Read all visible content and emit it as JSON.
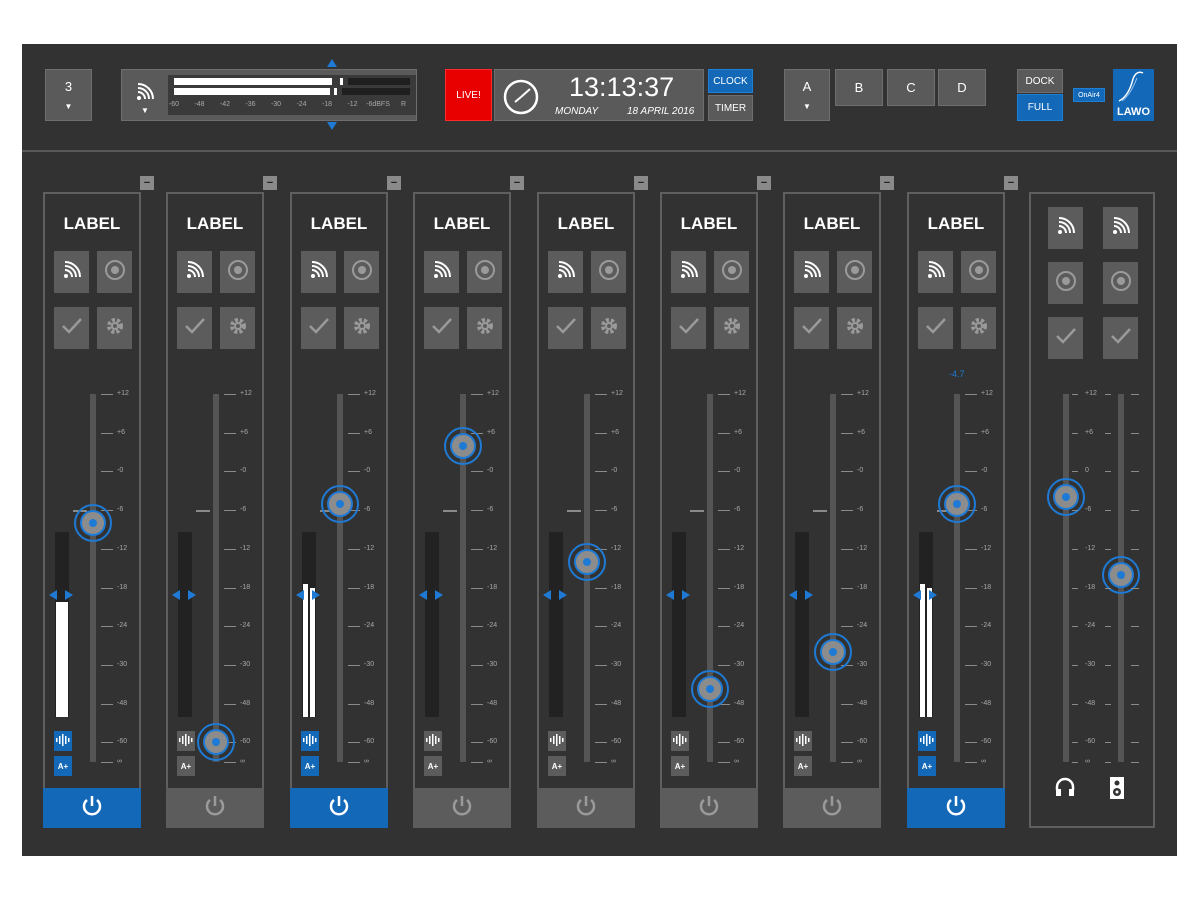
{
  "header": {
    "page_selector": {
      "value": "3"
    },
    "meter_scale": [
      "-60",
      "-48",
      "-42",
      "-36",
      "-30",
      "-24",
      "-18",
      "-12",
      "-6dBFS",
      "R"
    ],
    "live_label": "LIVE!",
    "clock": {
      "time": "13:13:37",
      "day": "MONDAY",
      "date": "18 APRIL 2016"
    },
    "clock_button": "CLOCK",
    "timer_button": "TIMER",
    "bank_selector": {
      "value": "A"
    },
    "banks": [
      "B",
      "C",
      "D"
    ],
    "dock_button": "DOCK",
    "full_button": "FULL",
    "onair_badge": "OnAir4",
    "logo_text": "LAWO"
  },
  "channels": [
    {
      "label": "LABEL",
      "fader_db": -8,
      "meter": 0.62,
      "power_on": true
    },
    {
      "label": "LABEL",
      "fader_db": -60,
      "meter": 0,
      "power_on": false
    },
    {
      "label": "LABEL",
      "fader_db": -5,
      "meter": 0.72,
      "power_on": true
    },
    {
      "label": "LABEL",
      "fader_db": 4,
      "meter": 0,
      "power_on": false
    },
    {
      "label": "LABEL",
      "fader_db": -14,
      "meter": 0,
      "power_on": false
    },
    {
      "label": "LABEL",
      "fader_db": -41,
      "meter": 0,
      "power_on": false
    },
    {
      "label": "LABEL",
      "fader_db": -28,
      "meter": 0,
      "power_on": false
    },
    {
      "label": "LABEL",
      "fader_db": -5,
      "meter": 0.72,
      "power_on": true,
      "readout": "-4.7"
    }
  ],
  "scale": [
    "+12",
    "+6",
    "-0",
    "-6",
    "-12",
    "-18",
    "-24",
    "-30",
    "-48",
    "-60",
    "∞"
  ],
  "monitor": {
    "scale": [
      "+12",
      "+6",
      "0",
      "-6",
      "-12",
      "-18",
      "-24",
      "-30",
      "-48",
      "-60",
      "∞"
    ],
    "headphone_fader_db": -4,
    "speaker_fader_db": -16
  },
  "colors": {
    "accent": "#1368b8",
    "live": "#e80000",
    "panel": "#323232"
  }
}
